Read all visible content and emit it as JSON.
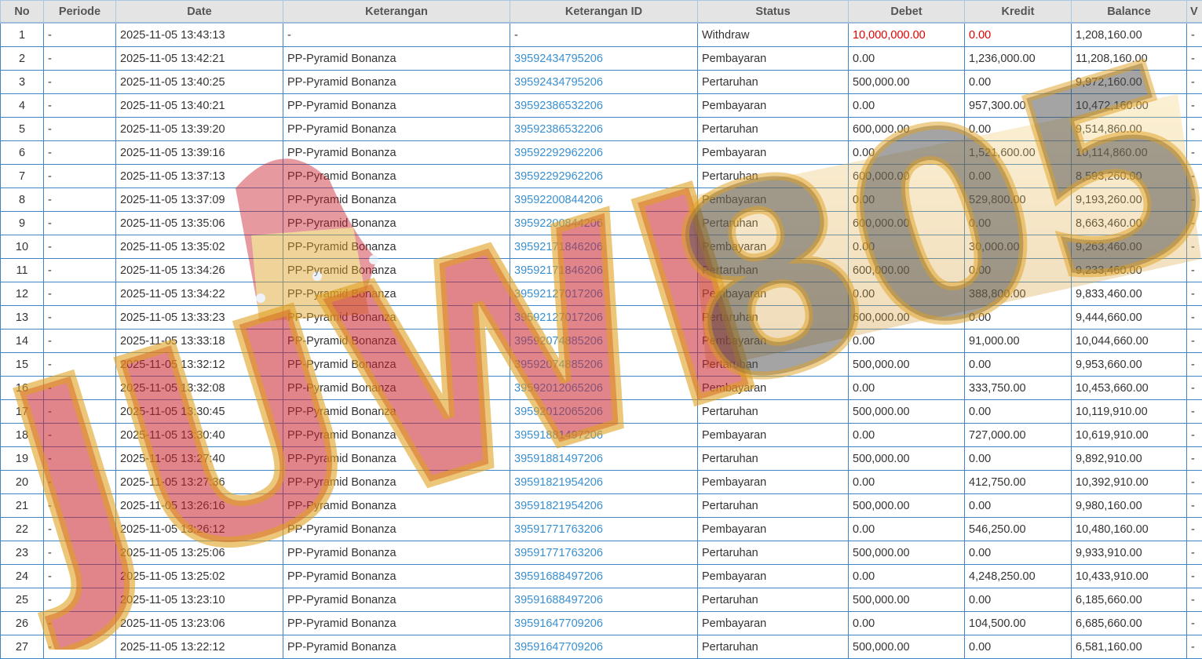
{
  "columns": [
    "No",
    "Periode",
    "Date",
    "Keterangan",
    "Keterangan ID",
    "Status",
    "Debet",
    "Kredit",
    "Balance",
    "V"
  ],
  "rows": [
    {
      "no": "1",
      "periode": "-",
      "date": "2025-11-05 13:43:13",
      "keterangan": "-",
      "ket_id": "-",
      "status": "Withdraw",
      "debet": "10,000,000.00",
      "kredit": "0.00",
      "balance": "1,208,160.00",
      "v": "-"
    },
    {
      "no": "2",
      "periode": "-",
      "date": "2025-11-05 13:42:21",
      "keterangan": "PP-Pyramid Bonanza",
      "ket_id": "39592434795206",
      "status": "Pembayaran",
      "debet": "0.00",
      "kredit": "1,236,000.00",
      "balance": "11,208,160.00",
      "v": "-"
    },
    {
      "no": "3",
      "periode": "-",
      "date": "2025-11-05 13:40:25",
      "keterangan": "PP-Pyramid Bonanza",
      "ket_id": "39592434795206",
      "status": "Pertaruhan",
      "debet": "500,000.00",
      "kredit": "0.00",
      "balance": "9,972,160.00",
      "v": "-"
    },
    {
      "no": "4",
      "periode": "-",
      "date": "2025-11-05 13:40:21",
      "keterangan": "PP-Pyramid Bonanza",
      "ket_id": "39592386532206",
      "status": "Pembayaran",
      "debet": "0.00",
      "kredit": "957,300.00",
      "balance": "10,472,160.00",
      "v": "-"
    },
    {
      "no": "5",
      "periode": "-",
      "date": "2025-11-05 13:39:20",
      "keterangan": "PP-Pyramid Bonanza",
      "ket_id": "39592386532206",
      "status": "Pertaruhan",
      "debet": "600,000.00",
      "kredit": "0.00",
      "balance": "9,514,860.00",
      "v": "-"
    },
    {
      "no": "6",
      "periode": "-",
      "date": "2025-11-05 13:39:16",
      "keterangan": "PP-Pyramid Bonanza",
      "ket_id": "39592292962206",
      "status": "Pembayaran",
      "debet": "0.00",
      "kredit": "1,521,600.00",
      "balance": "10,114,860.00",
      "v": "-"
    },
    {
      "no": "7",
      "periode": "-",
      "date": "2025-11-05 13:37:13",
      "keterangan": "PP-Pyramid Bonanza",
      "ket_id": "39592292962206",
      "status": "Pertaruhan",
      "debet": "600,000.00",
      "kredit": "0.00",
      "balance": "8,593,260.00",
      "v": "-"
    },
    {
      "no": "8",
      "periode": "-",
      "date": "2025-11-05 13:37:09",
      "keterangan": "PP-Pyramid Bonanza",
      "ket_id": "39592200844206",
      "status": "Pembayaran",
      "debet": "0.00",
      "kredit": "529,800.00",
      "balance": "9,193,260.00",
      "v": "-"
    },
    {
      "no": "9",
      "periode": "-",
      "date": "2025-11-05 13:35:06",
      "keterangan": "PP-Pyramid Bonanza",
      "ket_id": "39592200844206",
      "status": "Pertaruhan",
      "debet": "600,000.00",
      "kredit": "0.00",
      "balance": "8,663,460.00",
      "v": "-"
    },
    {
      "no": "10",
      "periode": "-",
      "date": "2025-11-05 13:35:02",
      "keterangan": "PP-Pyramid Bonanza",
      "ket_id": "39592171846206",
      "status": "Pembayaran",
      "debet": "0.00",
      "kredit": "30,000.00",
      "balance": "9,263,460.00",
      "v": "-"
    },
    {
      "no": "11",
      "periode": "-",
      "date": "2025-11-05 13:34:26",
      "keterangan": "PP-Pyramid Bonanza",
      "ket_id": "39592171846206",
      "status": "Pertaruhan",
      "debet": "600,000.00",
      "kredit": "0.00",
      "balance": "9,233,460.00",
      "v": "-"
    },
    {
      "no": "12",
      "periode": "-",
      "date": "2025-11-05 13:34:22",
      "keterangan": "PP-Pyramid Bonanza",
      "ket_id": "39592127017206",
      "status": "Pembayaran",
      "debet": "0.00",
      "kredit": "388,800.00",
      "balance": "9,833,460.00",
      "v": "-"
    },
    {
      "no": "13",
      "periode": "-",
      "date": "2025-11-05 13:33:23",
      "keterangan": "PP-Pyramid Bonanza",
      "ket_id": "39592127017206",
      "status": "Pertaruhan",
      "debet": "600,000.00",
      "kredit": "0.00",
      "balance": "9,444,660.00",
      "v": "-"
    },
    {
      "no": "14",
      "periode": "-",
      "date": "2025-11-05 13:33:18",
      "keterangan": "PP-Pyramid Bonanza",
      "ket_id": "39592074885206",
      "status": "Pembayaran",
      "debet": "0.00",
      "kredit": "91,000.00",
      "balance": "10,044,660.00",
      "v": "-"
    },
    {
      "no": "15",
      "periode": "-",
      "date": "2025-11-05 13:32:12",
      "keterangan": "PP-Pyramid Bonanza",
      "ket_id": "39592074885206",
      "status": "Pertaruhan",
      "debet": "500,000.00",
      "kredit": "0.00",
      "balance": "9,953,660.00",
      "v": "-"
    },
    {
      "no": "16",
      "periode": "-",
      "date": "2025-11-05 13:32:08",
      "keterangan": "PP-Pyramid Bonanza",
      "ket_id": "39592012065206",
      "status": "Pembayaran",
      "debet": "0.00",
      "kredit": "333,750.00",
      "balance": "10,453,660.00",
      "v": "-"
    },
    {
      "no": "17",
      "periode": "-",
      "date": "2025-11-05 13:30:45",
      "keterangan": "PP-Pyramid Bonanza",
      "ket_id": "39592012065206",
      "status": "Pertaruhan",
      "debet": "500,000.00",
      "kredit": "0.00",
      "balance": "10,119,910.00",
      "v": "-"
    },
    {
      "no": "18",
      "periode": "-",
      "date": "2025-11-05 13:30:40",
      "keterangan": "PP-Pyramid Bonanza",
      "ket_id": "39591881497206",
      "status": "Pembayaran",
      "debet": "0.00",
      "kredit": "727,000.00",
      "balance": "10,619,910.00",
      "v": "-"
    },
    {
      "no": "19",
      "periode": "-",
      "date": "2025-11-05 13:27:40",
      "keterangan": "PP-Pyramid Bonanza",
      "ket_id": "39591881497206",
      "status": "Pertaruhan",
      "debet": "500,000.00",
      "kredit": "0.00",
      "balance": "9,892,910.00",
      "v": "-"
    },
    {
      "no": "20",
      "periode": "-",
      "date": "2025-11-05 13:27:36",
      "keterangan": "PP-Pyramid Bonanza",
      "ket_id": "39591821954206",
      "status": "Pembayaran",
      "debet": "0.00",
      "kredit": "412,750.00",
      "balance": "10,392,910.00",
      "v": "-"
    },
    {
      "no": "21",
      "periode": "-",
      "date": "2025-11-05 13:26:16",
      "keterangan": "PP-Pyramid Bonanza",
      "ket_id": "39591821954206",
      "status": "Pertaruhan",
      "debet": "500,000.00",
      "kredit": "0.00",
      "balance": "9,980,160.00",
      "v": "-"
    },
    {
      "no": "22",
      "periode": "-",
      "date": "2025-11-05 13:26:12",
      "keterangan": "PP-Pyramid Bonanza",
      "ket_id": "39591771763206",
      "status": "Pembayaran",
      "debet": "0.00",
      "kredit": "546,250.00",
      "balance": "10,480,160.00",
      "v": "-"
    },
    {
      "no": "23",
      "periode": "-",
      "date": "2025-11-05 13:25:06",
      "keterangan": "PP-Pyramid Bonanza",
      "ket_id": "39591771763206",
      "status": "Pertaruhan",
      "debet": "500,000.00",
      "kredit": "0.00",
      "balance": "9,933,910.00",
      "v": "-"
    },
    {
      "no": "24",
      "periode": "-",
      "date": "2025-11-05 13:25:02",
      "keterangan": "PP-Pyramid Bonanza",
      "ket_id": "39591688497206",
      "status": "Pembayaran",
      "debet": "0.00",
      "kredit": "4,248,250.00",
      "balance": "10,433,910.00",
      "v": "-"
    },
    {
      "no": "25",
      "periode": "-",
      "date": "2025-11-05 13:23:10",
      "keterangan": "PP-Pyramid Bonanza",
      "ket_id": "39591688497206",
      "status": "Pertaruhan",
      "debet": "500,000.00",
      "kredit": "0.00",
      "balance": "6,185,660.00",
      "v": "-"
    },
    {
      "no": "26",
      "periode": "-",
      "date": "2025-11-05 13:23:06",
      "keterangan": "PP-Pyramid Bonanza",
      "ket_id": "39591647709206",
      "status": "Pembayaran",
      "debet": "0.00",
      "kredit": "104,500.00",
      "balance": "6,685,660.00",
      "v": "-"
    },
    {
      "no": "27",
      "periode": "-",
      "date": "2025-11-05 13:22:12",
      "keterangan": "PP-Pyramid Bonanza",
      "ket_id": "39591647709206",
      "status": "Pertaruhan",
      "debet": "500,000.00",
      "kredit": "0.00",
      "balance": "6,581,160.00",
      "v": "-"
    }
  ],
  "watermark": {
    "text_left": "JUWI",
    "text_right": "805",
    "main_color": "#c8202a",
    "accent_color": "#e0a020"
  },
  "colors": {
    "link": "#3a8fd0",
    "negative": "#e00000",
    "grid": "#3f84c5",
    "header_bg": "#e4e4e4"
  }
}
